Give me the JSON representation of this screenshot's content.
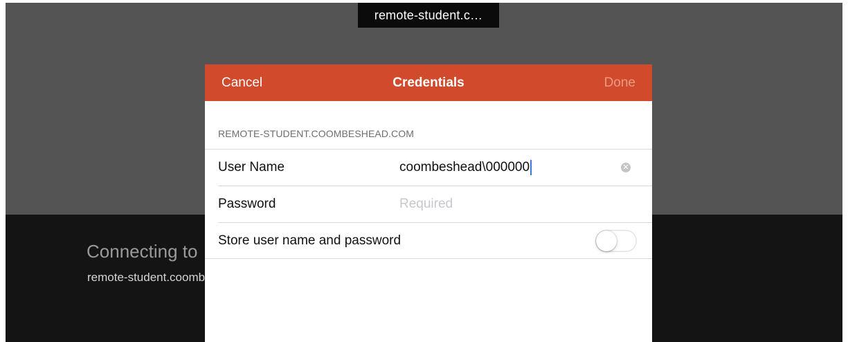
{
  "window": {
    "host_label": "remote-student.c…"
  },
  "background": {
    "connecting_title": "Connecting to",
    "connecting_host": "remote-student.coombeshead.com"
  },
  "dialog": {
    "header": {
      "cancel_label": "Cancel",
      "title": "Credentials",
      "done_label": "Done"
    },
    "section_header": "REMOTE-STUDENT.COOMBESHEAD.COM",
    "fields": {
      "username": {
        "label": "User Name",
        "value": "coombeshead\\000000"
      },
      "password": {
        "label": "Password",
        "placeholder": "Required",
        "value": ""
      },
      "store": {
        "label": "Store user name and password",
        "enabled": false
      }
    },
    "icons": {
      "clear": "clear-icon",
      "toggle": "toggle-switch"
    }
  },
  "colors": {
    "accent": "#d14a2b",
    "done_disabled": "#ec9a86",
    "top_background": "#545454",
    "bottom_background": "#141414"
  }
}
